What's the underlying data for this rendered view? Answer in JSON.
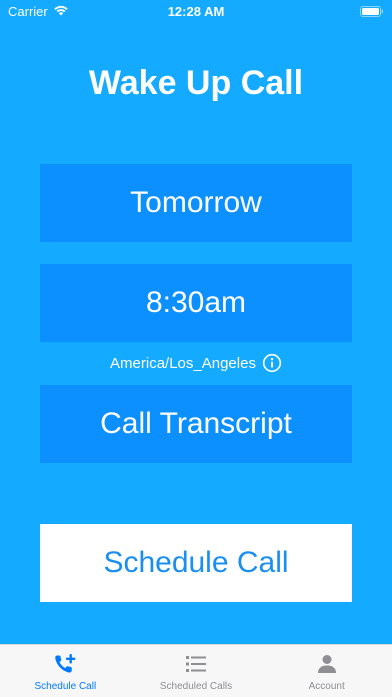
{
  "status_bar": {
    "carrier": "Carrier",
    "time": "12:28 AM"
  },
  "title": "Wake Up Call",
  "day_button": "Tomorrow",
  "time_button": "8:30am",
  "timezone": "America/Los_Angeles",
  "transcript_button": "Call Transcript",
  "schedule_button": "Schedule Call",
  "tabs": [
    {
      "label": "Schedule Call",
      "icon": "phone-plus-icon",
      "active": true
    },
    {
      "label": "Scheduled Calls",
      "icon": "list-icon",
      "active": false
    },
    {
      "label": "Account",
      "icon": "person-icon",
      "active": false
    }
  ],
  "colors": {
    "background": "#14aaff",
    "panel": "#0d90ff",
    "schedule_text": "#1a8ff0",
    "tab_active": "#007aff",
    "tab_inactive": "#8e8e93"
  }
}
